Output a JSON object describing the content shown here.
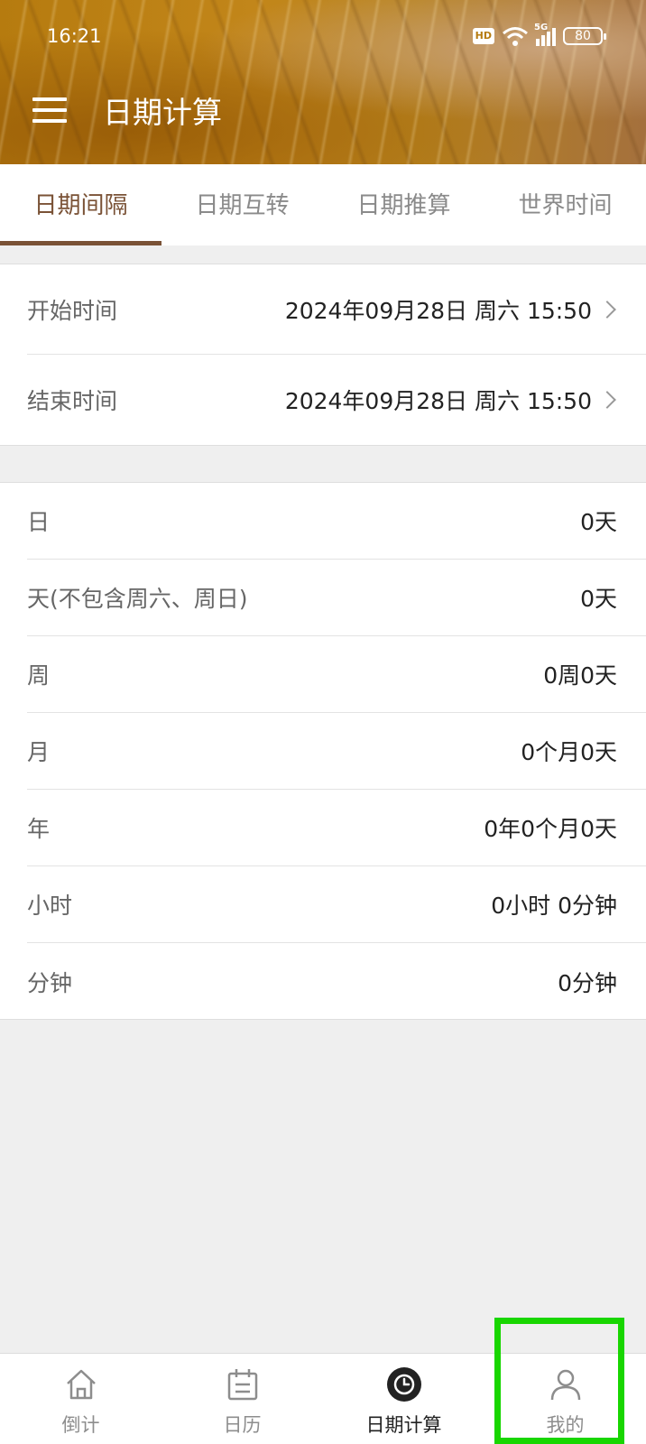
{
  "status_bar": {
    "time": "16:21",
    "hd": "HD",
    "network": "5G",
    "battery": "80"
  },
  "header": {
    "title": "日期计算",
    "menu_icon": "hamburger-menu-icon"
  },
  "tabs": [
    {
      "label": "日期间隔",
      "active": true
    },
    {
      "label": "日期互转",
      "active": false
    },
    {
      "label": "日期推算",
      "active": false
    },
    {
      "label": "世界时间",
      "active": false
    }
  ],
  "time_inputs": [
    {
      "label": "开始时间",
      "value": "2024年09月28日 周六 15:50"
    },
    {
      "label": "结束时间",
      "value": "2024年09月28日 周六 15:50"
    }
  ],
  "results": [
    {
      "label": "日",
      "value": "0天"
    },
    {
      "label": "天(不包含周六、周日)",
      "value": "0天"
    },
    {
      "label": "周",
      "value": "0周0天"
    },
    {
      "label": "月",
      "value": "0个月0天"
    },
    {
      "label": "年",
      "value": "0年0个月0天"
    },
    {
      "label": "小时",
      "value": "0小时 0分钟"
    },
    {
      "label": "分钟",
      "value": "0分钟"
    }
  ],
  "bottom_nav": [
    {
      "label": "倒计",
      "icon": "home-icon",
      "active": false
    },
    {
      "label": "日历",
      "icon": "calendar-icon",
      "active": false
    },
    {
      "label": "日期计算",
      "icon": "clock-icon",
      "active": true
    },
    {
      "label": "我的",
      "icon": "profile-icon",
      "active": false
    }
  ],
  "colors": {
    "accent": "#7a5236",
    "highlight": "#18d600"
  }
}
